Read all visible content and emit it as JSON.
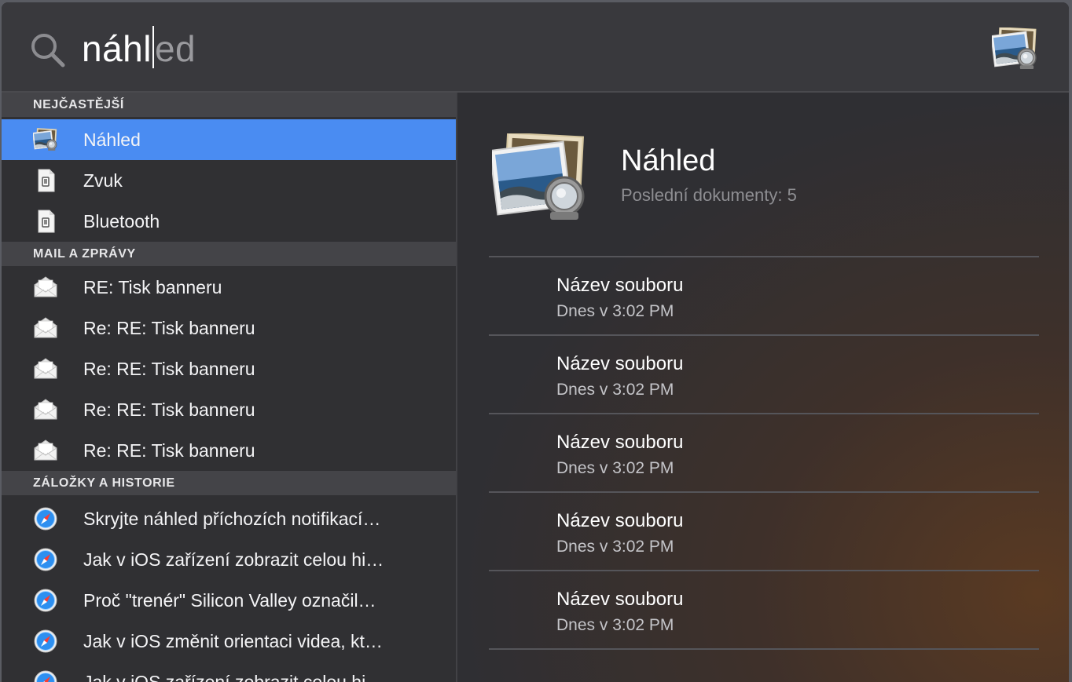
{
  "search": {
    "typed": "náhl",
    "completion": "ed"
  },
  "sections": [
    {
      "header": "NEJČASTĚJŠÍ",
      "items": [
        {
          "label": "Náhled",
          "icon": "preview-app-icon",
          "selected": true
        },
        {
          "label": "Zvuk",
          "icon": "preference-pane-icon",
          "selected": false
        },
        {
          "label": "Bluetooth",
          "icon": "preference-pane-icon",
          "selected": false
        }
      ]
    },
    {
      "header": "MAIL A ZPRÁVY",
      "items": [
        {
          "label": "RE: Tisk banneru",
          "icon": "mail-envelope-icon"
        },
        {
          "label": "Re: RE: Tisk banneru",
          "icon": "mail-envelope-icon"
        },
        {
          "label": "Re: RE: Tisk banneru",
          "icon": "mail-envelope-icon"
        },
        {
          "label": "Re: RE: Tisk banneru",
          "icon": "mail-envelope-icon"
        },
        {
          "label": "Re: RE: Tisk banneru",
          "icon": "mail-envelope-icon"
        }
      ]
    },
    {
      "header": "ZÁLOŽKY A HISTORIE",
      "items": [
        {
          "label": "Skryjte náhled příchozích notifikací…",
          "icon": "safari-compass-icon"
        },
        {
          "label": "Jak v iOS zařízení zobrazit celou hi…",
          "icon": "safari-compass-icon"
        },
        {
          "label": "Proč \"trenér\" Silicon Valley označil…",
          "icon": "safari-compass-icon"
        },
        {
          "label": "Jak v iOS změnit orientaci videa, kt…",
          "icon": "safari-compass-icon"
        },
        {
          "label": "Jak v iOS zařízení zobrazit celou hi…",
          "icon": "safari-compass-icon"
        }
      ]
    }
  ],
  "preview": {
    "title": "Náhled",
    "subtitle": "Poslední dokumenty: 5",
    "documents": [
      {
        "name": "Název souboru",
        "date": "Dnes v 3:02 PM"
      },
      {
        "name": "Název souboru",
        "date": "Dnes v 3:02 PM"
      },
      {
        "name": "Název souboru",
        "date": "Dnes v 3:02 PM"
      },
      {
        "name": "Název souboru",
        "date": "Dnes v 3:02 PM"
      },
      {
        "name": "Název souboru",
        "date": "Dnes v 3:02 PM"
      }
    ]
  },
  "colors": {
    "selection": "#4a8cf2",
    "background": "#2e2e31"
  }
}
